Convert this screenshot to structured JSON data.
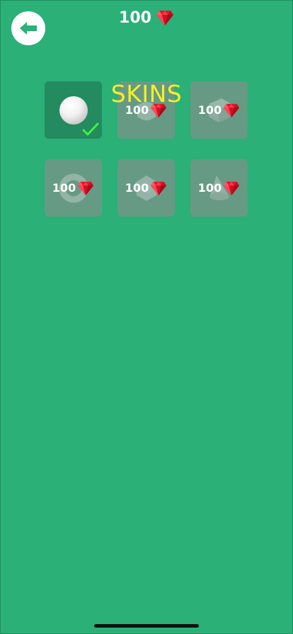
{
  "header": {
    "back_icon": "arrow-left-icon",
    "currency_amount": "100",
    "currency_icon": "ruby-gem-icon"
  },
  "title": "SKINS",
  "colors": {
    "background": "#2bb078",
    "title": "#f4ef26",
    "tile": "#8c8c8c",
    "tile_selected": "#248a5f",
    "gem": "#e3162b",
    "check": "#3ef04a"
  },
  "skins": [
    {
      "shape": "sphere",
      "selected": true,
      "owned": true,
      "status_icon": "checkmark-icon"
    },
    {
      "shape": "rounded-cube",
      "price": "100"
    },
    {
      "shape": "cube",
      "price": "100"
    },
    {
      "shape": "ring",
      "price": "100"
    },
    {
      "shape": "dodecahedron",
      "price": "100"
    },
    {
      "shape": "cone",
      "price": "100"
    }
  ]
}
